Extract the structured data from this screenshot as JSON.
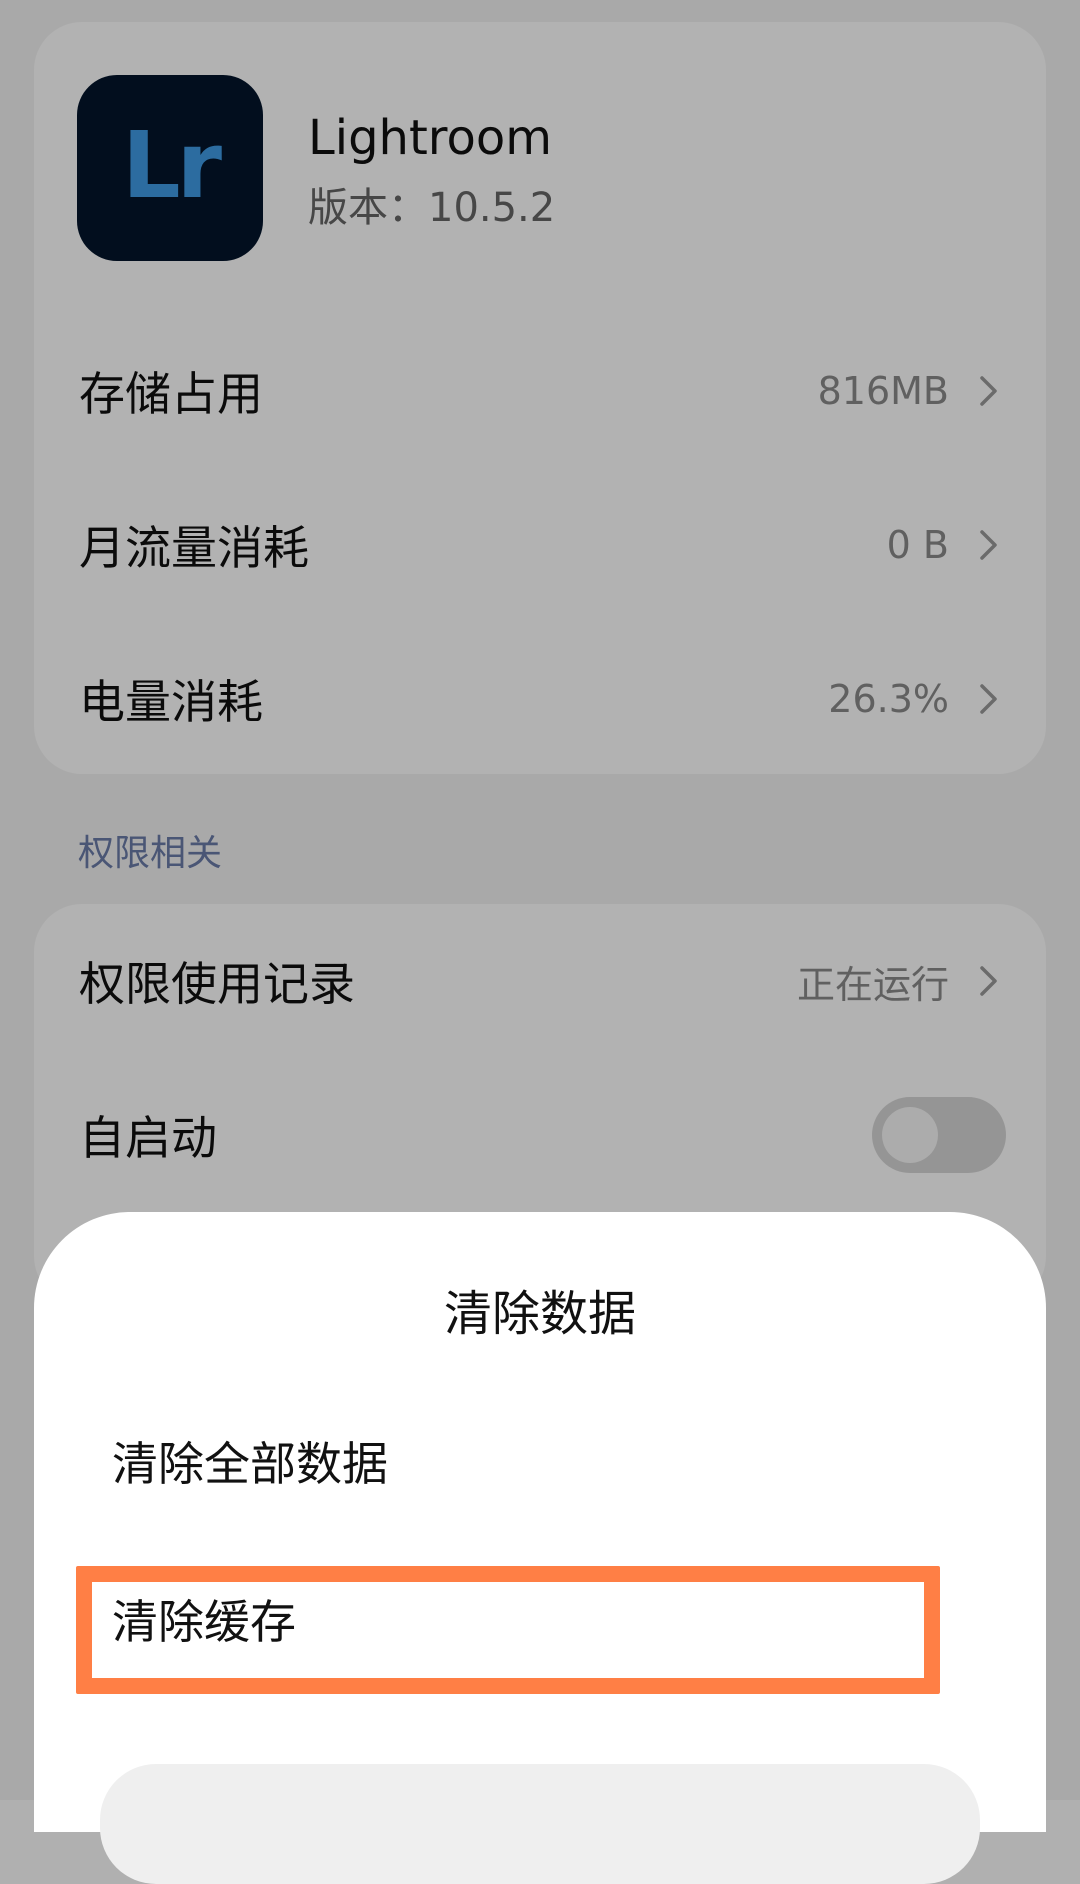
{
  "app": {
    "name": "Lightroom",
    "version": "版本：10.5.2",
    "icon_text": "Lr",
    "icon_bg": "#03152b",
    "icon_fg": "#3f9be6"
  },
  "info_rows": [
    {
      "label": "存储占用",
      "value": "816MB"
    },
    {
      "label": "月流量消耗",
      "value": "0 B"
    },
    {
      "label": "电量消耗",
      "value": "26.3%"
    }
  ],
  "permissions_section": {
    "header": "权限相关",
    "usage_record": {
      "label": "权限使用记录",
      "value": "正在运行"
    },
    "autostart": {
      "label": "自启动",
      "enabled": false
    }
  },
  "dialog": {
    "title": "清除数据",
    "options": {
      "clear_all": "清除全部数据",
      "clear_cache": "清除缓存"
    },
    "highlight_color": "#ff7f45"
  },
  "icons": {
    "chevron": "chevron-right-icon"
  }
}
